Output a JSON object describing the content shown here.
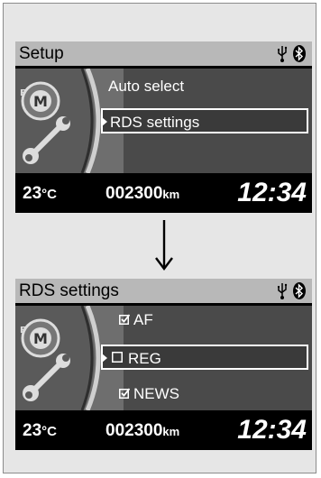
{
  "screens": [
    {
      "title": "Setup",
      "items": [
        {
          "label": "Auto select",
          "selected": false,
          "checkbox": null
        },
        {
          "label": "RDS settings",
          "selected": true,
          "checkbox": null
        }
      ],
      "temperature": {
        "value": "23",
        "unit": "°C"
      },
      "odometer": {
        "value": "002300",
        "unit": "km"
      },
      "clock": "12:34"
    },
    {
      "title": "RDS settings",
      "items": [
        {
          "label": "AF",
          "selected": false,
          "checkbox": "checked"
        },
        {
          "label": "REG",
          "selected": true,
          "checkbox": "unchecked"
        },
        {
          "label": "NEWS",
          "selected": false,
          "checkbox": "checked"
        }
      ],
      "temperature": {
        "value": "23",
        "unit": "°C"
      },
      "odometer": {
        "value": "002300",
        "unit": "km"
      },
      "clock": "12:34"
    }
  ],
  "icons": {
    "usb": "usb-icon",
    "bluetooth": "bluetooth-icon",
    "settings": "settings-wrench-icon",
    "transition": "down-arrow-icon"
  },
  "colors": {
    "screen_background": "#000000",
    "title_bar": "#b8b8b8",
    "menu_area": "#4a4a4a",
    "text": "#ffffff"
  }
}
